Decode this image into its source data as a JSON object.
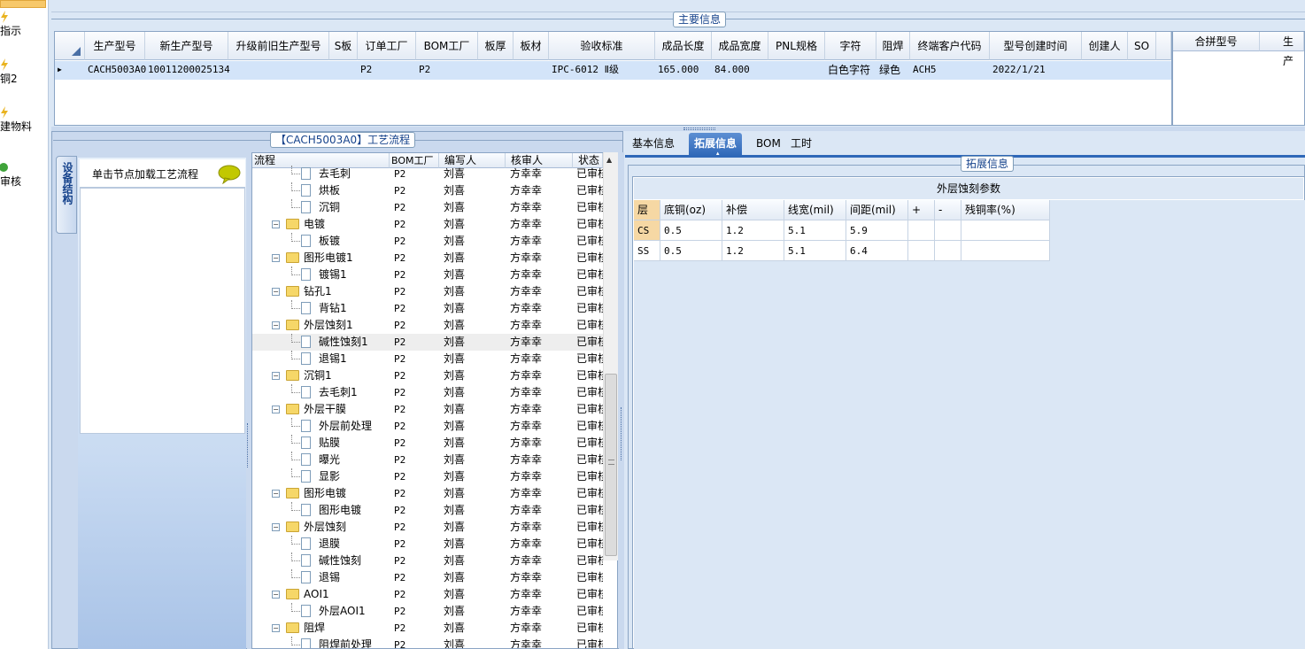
{
  "left_nav": {
    "items": [
      {
        "label": "指示",
        "icon": "lightning-icon"
      },
      {
        "label": "铜2",
        "icon": "lightning-icon"
      },
      {
        "label": "建物料",
        "icon": "lightning-icon"
      },
      {
        "label": "审核",
        "icon": "green-check-icon"
      }
    ]
  },
  "main_info": {
    "legend": "主要信息",
    "columns": [
      "生产型号",
      "新生产型号",
      "升级前旧生产型号",
      "S板",
      "订单工厂",
      "BOM工厂",
      "板厚",
      "板材",
      "验收标准",
      "成品长度",
      "成品宽度",
      "PNL规格",
      "字符",
      "阻焊",
      "终端客户代码",
      "型号创建时间",
      "创建人",
      "SO"
    ],
    "row": {
      "生产型号": "CACH5003A0",
      "新生产型号": "10011200025134",
      "升级前旧生产型号": "",
      "S板": "",
      "订单工厂": "P2",
      "BOM工厂": "P2",
      "板厚": "",
      "板材": "",
      "验收标准": "IPC-6012 Ⅱ级",
      "成品长度": "165.000",
      "成品宽度": "84.000",
      "PNL规格": "",
      "字符": "白色字符",
      "阻焊": "绿色",
      "终端客户代码": "ACH5",
      "型号创建时间": "2022/1/21",
      "创建人": "",
      "SO": ""
    },
    "side_columns": [
      "合拼型号",
      "生产"
    ]
  },
  "process": {
    "legend": "【CACH5003A0】工艺流程",
    "vertical_tab": "设备结构",
    "load_hint": "单击节点加载工艺流程",
    "columns": [
      "流程",
      "BOM工厂",
      "编写人",
      "核审人",
      "状态"
    ],
    "rows": [
      {
        "name": "去毛刺",
        "level": 1,
        "factory": "P2",
        "writer": "刘喜",
        "reviewer": "方幸幸",
        "status": "已审核"
      },
      {
        "name": "烘板",
        "level": 1,
        "factory": "P2",
        "writer": "刘喜",
        "reviewer": "方幸幸",
        "status": "已审核"
      },
      {
        "name": "沉铜",
        "level": 1,
        "factory": "P2",
        "writer": "刘喜",
        "reviewer": "方幸幸",
        "status": "已审核"
      },
      {
        "name": "电镀",
        "level": 0,
        "factory": "P2",
        "writer": "刘喜",
        "reviewer": "方幸幸",
        "status": "已审核"
      },
      {
        "name": "板镀",
        "level": 1,
        "factory": "P2",
        "writer": "刘喜",
        "reviewer": "方幸幸",
        "status": "已审核"
      },
      {
        "name": "图形电镀1",
        "level": 0,
        "factory": "P2",
        "writer": "刘喜",
        "reviewer": "方幸幸",
        "status": "已审核"
      },
      {
        "name": "镀锡1",
        "level": 1,
        "factory": "P2",
        "writer": "刘喜",
        "reviewer": "方幸幸",
        "status": "已审核"
      },
      {
        "name": "钻孔1",
        "level": 0,
        "factory": "P2",
        "writer": "刘喜",
        "reviewer": "方幸幸",
        "status": "已审核"
      },
      {
        "name": "背钻1",
        "level": 1,
        "factory": "P2",
        "writer": "刘喜",
        "reviewer": "方幸幸",
        "status": "已审核"
      },
      {
        "name": "外层蚀刻1",
        "level": 0,
        "factory": "P2",
        "writer": "刘喜",
        "reviewer": "方幸幸",
        "status": "已审核"
      },
      {
        "name": "碱性蚀刻1",
        "level": 1,
        "factory": "P2",
        "writer": "刘喜",
        "reviewer": "方幸幸",
        "status": "已审核",
        "selected": true
      },
      {
        "name": "退锡1",
        "level": 1,
        "factory": "P2",
        "writer": "刘喜",
        "reviewer": "方幸幸",
        "status": "已审核"
      },
      {
        "name": "沉铜1",
        "level": 0,
        "factory": "P2",
        "writer": "刘喜",
        "reviewer": "方幸幸",
        "status": "已审核"
      },
      {
        "name": "去毛刺1",
        "level": 1,
        "factory": "P2",
        "writer": "刘喜",
        "reviewer": "方幸幸",
        "status": "已审核"
      },
      {
        "name": "外层干膜",
        "level": 0,
        "factory": "P2",
        "writer": "刘喜",
        "reviewer": "方幸幸",
        "status": "已审核"
      },
      {
        "name": "外层前处理",
        "level": 1,
        "factory": "P2",
        "writer": "刘喜",
        "reviewer": "方幸幸",
        "status": "已审核"
      },
      {
        "name": "贴膜",
        "level": 1,
        "factory": "P2",
        "writer": "刘喜",
        "reviewer": "方幸幸",
        "status": "已审核"
      },
      {
        "name": "曝光",
        "level": 1,
        "factory": "P2",
        "writer": "刘喜",
        "reviewer": "方幸幸",
        "status": "已审核"
      },
      {
        "name": "显影",
        "level": 1,
        "factory": "P2",
        "writer": "刘喜",
        "reviewer": "方幸幸",
        "status": "已审核"
      },
      {
        "name": "图形电镀",
        "level": 0,
        "factory": "P2",
        "writer": "刘喜",
        "reviewer": "方幸幸",
        "status": "已审核"
      },
      {
        "name": "图形电镀",
        "level": 1,
        "factory": "P2",
        "writer": "刘喜",
        "reviewer": "方幸幸",
        "status": "已审核"
      },
      {
        "name": "外层蚀刻",
        "level": 0,
        "factory": "P2",
        "writer": "刘喜",
        "reviewer": "方幸幸",
        "status": "已审核"
      },
      {
        "name": "退膜",
        "level": 1,
        "factory": "P2",
        "writer": "刘喜",
        "reviewer": "方幸幸",
        "status": "已审核"
      },
      {
        "name": "碱性蚀刻",
        "level": 1,
        "factory": "P2",
        "writer": "刘喜",
        "reviewer": "方幸幸",
        "status": "已审核"
      },
      {
        "name": "退锡",
        "level": 1,
        "factory": "P2",
        "writer": "刘喜",
        "reviewer": "方幸幸",
        "status": "已审核"
      },
      {
        "name": "AOI1",
        "level": 0,
        "factory": "P2",
        "writer": "刘喜",
        "reviewer": "方幸幸",
        "status": "已审核"
      },
      {
        "name": "外层AOI1",
        "level": 1,
        "factory": "P2",
        "writer": "刘喜",
        "reviewer": "方幸幸",
        "status": "已审核"
      },
      {
        "name": "阻焊",
        "level": 0,
        "factory": "P2",
        "writer": "刘喜",
        "reviewer": "方幸幸",
        "status": "已审核"
      },
      {
        "name": "阻焊前处理",
        "level": 1,
        "factory": "P2",
        "writer": "刘喜",
        "reviewer": "方幸幸",
        "status": "已审核"
      }
    ]
  },
  "detail_tabs": {
    "items": [
      "基本信息",
      "拓展信息",
      "BOM",
      "工时"
    ],
    "active": "拓展信息"
  },
  "extended": {
    "legend": "拓展信息",
    "table_title": "外层蚀刻参数",
    "columns": [
      "层",
      "底铜(oz)",
      "补偿",
      "线宽(mil)",
      "间距(mil)",
      "+",
      "-",
      "残铜率(%)"
    ],
    "rows": [
      [
        "CS",
        "0.5",
        "1.2",
        "5.1",
        "5.9",
        "",
        "",
        ""
      ],
      [
        "SS",
        "0.5",
        "1.2",
        "5.1",
        "6.4",
        "",
        "",
        ""
      ]
    ]
  },
  "colors": {
    "selected_row": "#d3e4f9",
    "active_tab": "#2f68b8",
    "panel_bg": "#dbe7f5"
  }
}
